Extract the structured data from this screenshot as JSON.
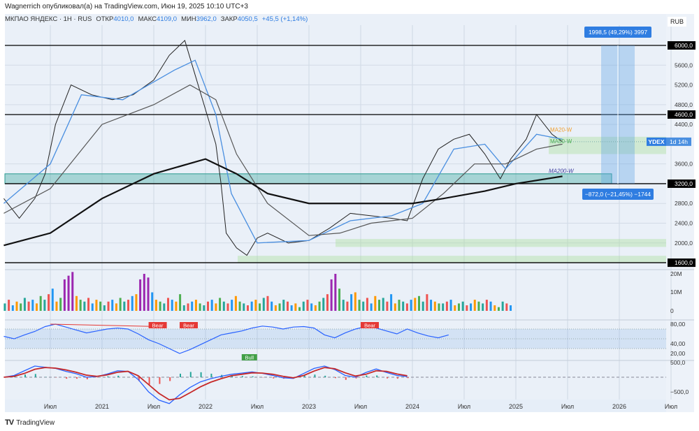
{
  "header": {
    "published": "Wagnerrich опубликовал(а) на TradingView.com, Июн 19, 2025 10:10 UTC+3",
    "symbol": "МКПАО ЯНДЕКС · 1Н · RUS",
    "open_label": "ОТКР",
    "open": "4010,0",
    "high_label": "МАКС",
    "high": "4109,0",
    "low_label": "МИН",
    "low": "3962,0",
    "close_label": "ЗАКР",
    "close": "4050,5",
    "change": "+45,5 (+1,14%)"
  },
  "currency": "RUB",
  "footer": {
    "brand": "TradingView"
  },
  "colors": {
    "bg": "#eaf0f8",
    "ma20": "#4a8fe0",
    "ma50": "#555555",
    "ma200": "#111111",
    "accent": "#2f7de1"
  },
  "chart_data": {
    "type": "line",
    "title": "МКПАО ЯНДЕКС 1H",
    "yrange": [
      1300,
      6600
    ],
    "price_ticks": [
      "6000,0",
      "5600,0",
      "5200,0",
      "4800,0",
      "4600,0",
      "4400,0",
      "3600,0",
      "3200,0",
      "2800,0",
      "2400,0",
      "2000,0",
      "1600,0"
    ],
    "price_tick_values": [
      6000,
      5600,
      5200,
      4800,
      4600,
      4400,
      3600,
      3200,
      2800,
      2400,
      2000,
      1600
    ],
    "highlighted_levels": [
      6000,
      4600,
      3200,
      1600
    ],
    "time_ticks": [
      {
        "t": 2020.5,
        "label": "Июл"
      },
      {
        "t": 2021,
        "label": "2021"
      },
      {
        "t": 2021.5,
        "label": "Июл"
      },
      {
        "t": 2022,
        "label": "2022"
      },
      {
        "t": 2022.5,
        "label": "Июл"
      },
      {
        "t": 2023,
        "label": "2023"
      },
      {
        "t": 2023.5,
        "label": "Июл"
      },
      {
        "t": 2024,
        "label": "2024"
      },
      {
        "t": 2024.5,
        "label": "Июл"
      },
      {
        "t": 2025,
        "label": "2025"
      },
      {
        "t": 2025.5,
        "label": "Июл"
      },
      {
        "t": 2026,
        "label": "2026"
      },
      {
        "t": 2026.5,
        "label": "Июл"
      }
    ],
    "series": [
      {
        "name": "Close",
        "x": [
          2020.05,
          2020.2,
          2020.35,
          2020.45,
          2020.55,
          2020.7,
          2020.9,
          2021.1,
          2021.3,
          2021.5,
          2021.65,
          2021.8,
          2021.9,
          2022.0,
          2022.1,
          2022.15,
          2022.2,
          2022.3,
          2022.4,
          2022.5,
          2022.6,
          2022.8,
          2023.0,
          2023.2,
          2023.4,
          2023.6,
          2023.8,
          2023.95,
          2024.1,
          2024.25,
          2024.4,
          2024.55,
          2024.7,
          2024.85,
          2024.95,
          2025.1,
          2025.2,
          2025.35,
          2025.45
        ],
        "y": [
          2900,
          2500,
          2900,
          3400,
          4400,
          5200,
          5000,
          4900,
          5000,
          5300,
          5800,
          6100,
          5400,
          4700,
          4000,
          3200,
          2200,
          1900,
          1750,
          2100,
          2200,
          2000,
          2050,
          2300,
          2600,
          2550,
          2500,
          2450,
          3300,
          3900,
          4100,
          4200,
          3800,
          3300,
          3700,
          4100,
          4600,
          4200,
          4050
        ]
      },
      {
        "name": "MA20-W",
        "x": [
          2020.05,
          2020.5,
          2020.8,
          2021.2,
          2021.7,
          2021.9,
          2022.1,
          2022.25,
          2022.5,
          2023.0,
          2023.4,
          2023.8,
          2024.1,
          2024.4,
          2024.7,
          2024.9,
          2025.2,
          2025.45
        ],
        "y": [
          2800,
          3600,
          5000,
          4900,
          5500,
          5700,
          4600,
          3000,
          2000,
          2050,
          2450,
          2550,
          2800,
          3900,
          4000,
          3500,
          4200,
          4100
        ]
      },
      {
        "name": "MA50-W",
        "x": [
          2020.05,
          2020.5,
          2021.0,
          2021.5,
          2021.85,
          2022.1,
          2022.3,
          2022.6,
          2023.0,
          2023.3,
          2023.6,
          2024.0,
          2024.3,
          2024.6,
          2024.9,
          2025.2,
          2025.45
        ],
        "y": [
          2600,
          3100,
          4400,
          4800,
          5200,
          4900,
          3800,
          2800,
          2150,
          2200,
          2400,
          2500,
          3000,
          3600,
          3600,
          3900,
          4000
        ]
      },
      {
        "name": "MA200-W",
        "x": [
          2020.05,
          2020.5,
          2021.0,
          2021.5,
          2022.0,
          2022.3,
          2022.6,
          2023.0,
          2023.5,
          2024.0,
          2024.3,
          2024.7,
          2025.0,
          2025.45
        ],
        "y": [
          1950,
          2200,
          2900,
          3400,
          3700,
          3400,
          3000,
          2800,
          2800,
          2800,
          2900,
          3050,
          3200,
          3350
        ]
      }
    ],
    "ma_labels": [
      "MA20-W",
      "MA50-W",
      "MA200-W"
    ],
    "measure": {
      "up": "1998,5 (49,29%) 3997",
      "down": "−872,0 (−21,45%) −1744",
      "from": 3200,
      "to": 6000
    },
    "ticker_tag": {
      "symbol": "YDEX",
      "countdown": "1d 14h",
      "price": 4050
    },
    "volume": {
      "ticks": [
        "20M",
        "10M",
        "0"
      ],
      "unit": "M",
      "start": 2020.05,
      "step": 0.0385,
      "values": [
        4,
        6,
        3,
        5,
        4,
        7,
        5,
        6,
        4,
        8,
        6,
        9,
        12,
        5,
        7,
        17,
        19,
        21,
        8,
        6,
        5,
        7,
        4,
        6,
        5,
        3,
        5,
        6,
        4,
        7,
        5,
        6,
        8,
        9,
        17,
        20,
        18,
        10,
        6,
        5,
        4,
        7,
        6,
        5,
        9,
        3,
        4,
        5,
        6,
        4,
        3,
        5,
        6,
        4,
        7,
        5,
        4,
        6,
        8,
        5,
        4,
        3,
        5,
        6,
        4,
        7,
        8,
        5,
        3,
        4,
        6,
        5,
        3,
        4,
        2,
        5,
        6,
        4,
        3,
        5,
        7,
        9,
        17,
        20,
        12,
        6,
        5,
        9,
        10,
        6,
        5,
        7,
        4,
        8,
        6,
        7,
        5,
        9,
        4,
        6,
        5,
        4,
        6,
        7,
        8,
        5,
        9,
        6,
        5,
        4,
        4,
        5,
        6,
        3,
        4,
        5,
        3,
        4,
        6,
        5,
        4,
        6,
        5,
        3,
        2,
        5,
        4,
        3
      ]
    },
    "rsi": {
      "ticks": [
        "80,00",
        "40,00",
        "20,00"
      ],
      "start": 2020.05,
      "step": 0.1,
      "values": [
        55,
        50,
        58,
        65,
        75,
        80,
        74,
        68,
        62,
        66,
        70,
        72,
        70,
        60,
        48,
        40,
        30,
        20,
        28,
        38,
        48,
        58,
        62,
        66,
        72,
        76,
        74,
        70,
        74,
        75,
        72,
        58,
        52,
        62,
        70,
        75,
        72,
        66,
        60,
        70,
        62,
        56,
        52,
        58
      ],
      "labels": {
        "bear": "Bear",
        "bull": "Bull"
      }
    },
    "macd": {
      "ticks": [
        "500,0",
        "−500,0"
      ],
      "start": 2020.05,
      "step": 0.1,
      "macd": [
        0,
        60,
        220,
        380,
        340,
        300,
        200,
        120,
        0,
        20,
        110,
        220,
        200,
        -80,
        -500,
        -780,
        -900,
        -600,
        -350,
        -160,
        -50,
        30,
        100,
        140,
        180,
        130,
        60,
        -20,
        -40,
        130,
        300,
        380,
        260,
        60,
        0,
        160,
        280,
        160,
        60,
        20
      ],
      "signal": [
        0,
        30,
        130,
        270,
        330,
        310,
        250,
        170,
        70,
        30,
        80,
        170,
        200,
        50,
        -250,
        -550,
        -770,
        -720,
        -530,
        -330,
        -170,
        -50,
        50,
        100,
        150,
        140,
        100,
        30,
        -20,
        60,
        210,
        330,
        290,
        150,
        40,
        100,
        220,
        200,
        110,
        50
      ]
    }
  }
}
